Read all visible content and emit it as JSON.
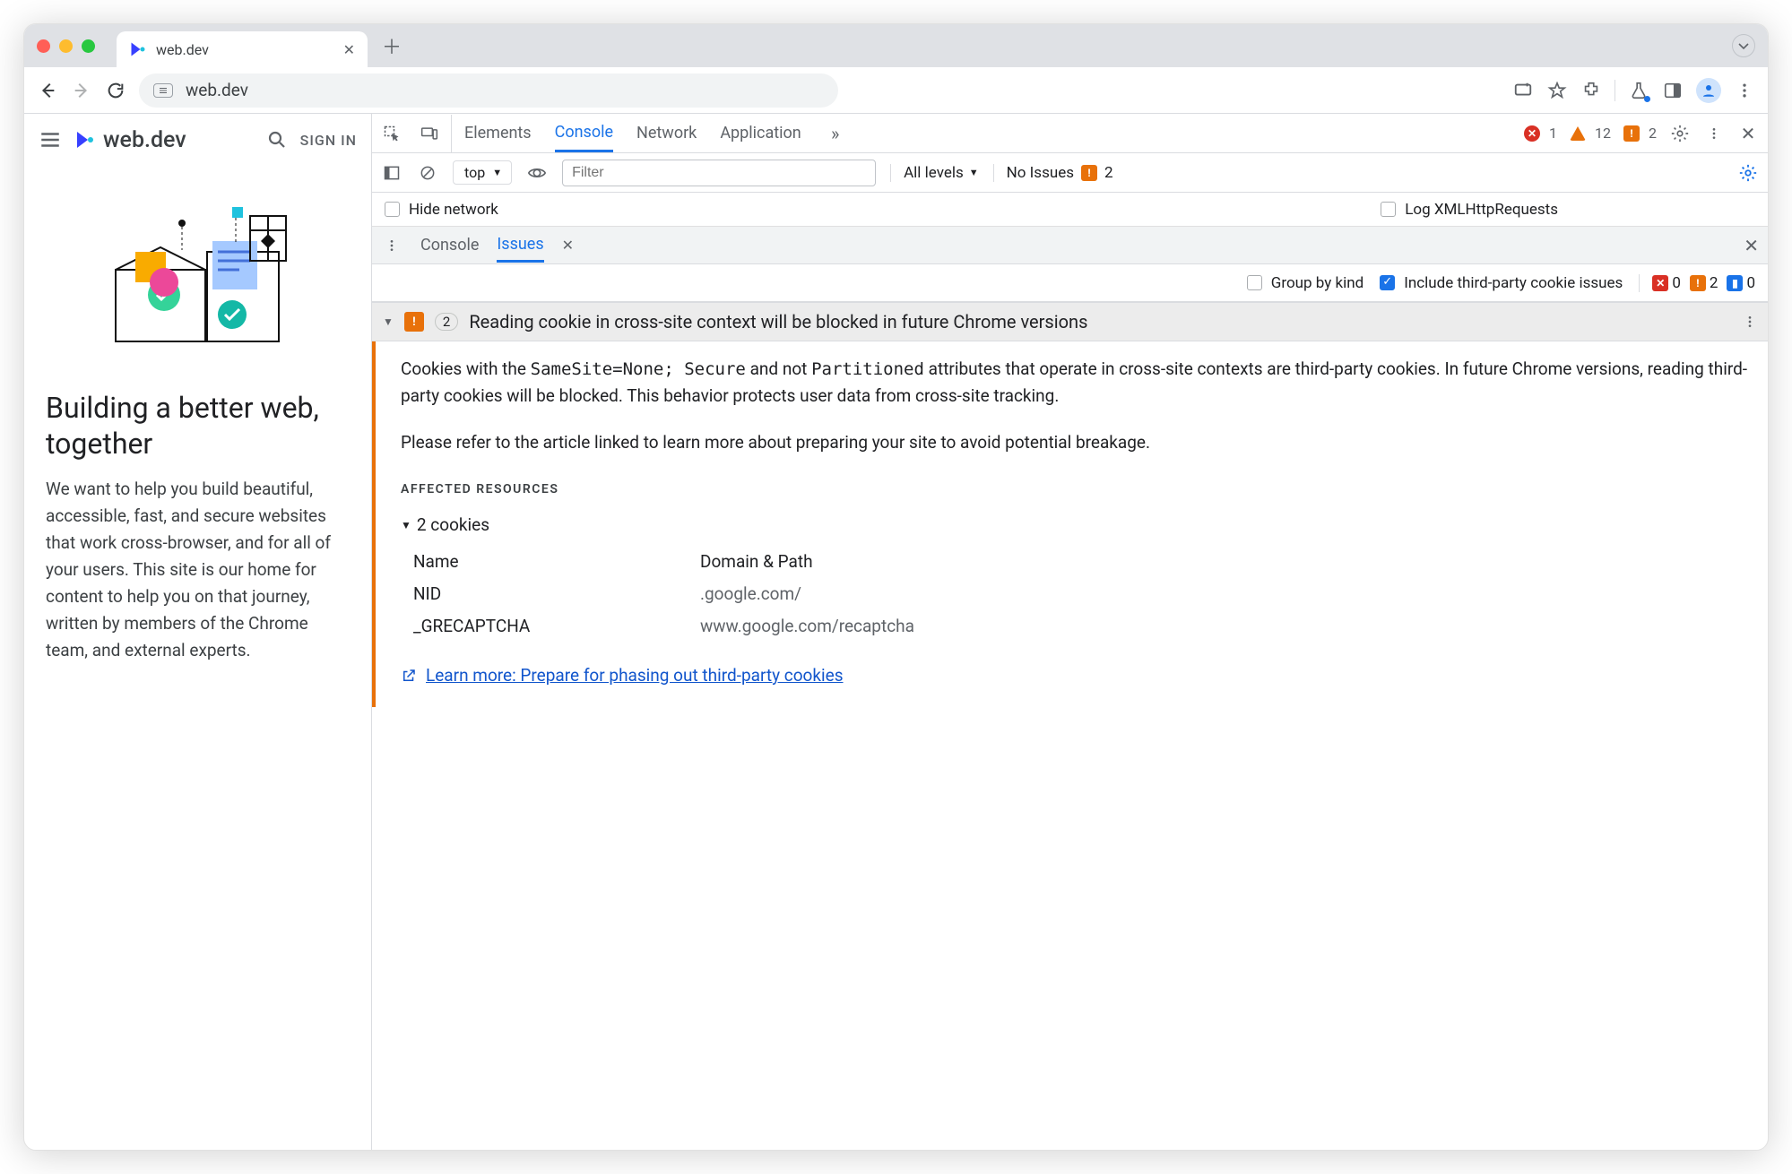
{
  "browser": {
    "tab_title": "web.dev",
    "url": "web.dev"
  },
  "page": {
    "brand": "web.dev",
    "signin": "SIGN IN",
    "headline": "Building a better web, together",
    "description": "We want to help you build beautiful, accessible, fast, and secure websites that work cross-browser, and for all of your users. This site is our home for content to help you on that journey, written by members of the Chrome team, and external experts."
  },
  "devtools": {
    "tabs": [
      "Elements",
      "Console",
      "Network",
      "Application"
    ],
    "active_tab": "Console",
    "status": {
      "errors": 1,
      "warnings": 12,
      "flags": 2
    },
    "filter": {
      "context": "top",
      "placeholder": "Filter",
      "levels": "All levels",
      "no_issues_label": "No Issues",
      "no_issues_count": 2
    },
    "console_settings": {
      "hide_network": "Hide network",
      "log_xhr": "Log XMLHttpRequests"
    },
    "drawer": {
      "tabs": [
        "Console",
        "Issues"
      ],
      "active": "Issues"
    },
    "issues_opts": {
      "group_by_kind": "Group by kind",
      "include_third_party": "Include third-party cookie issues",
      "counts": {
        "red": 0,
        "orange": 2,
        "blue": 0
      }
    },
    "issue": {
      "count": 2,
      "title": "Reading cookie in cross-site context will be blocked in future Chrome versions",
      "para1_pre": "Cookies with the ",
      "code1": "SameSite=None; Secure",
      "para1_mid": " and not ",
      "code2": "Partitioned",
      "para1_post": " attributes that operate in cross-site contexts are third-party cookies. In future Chrome versions, reading third-party cookies will be blocked. This behavior protects user data from cross-site tracking.",
      "para2": "Please refer to the article linked to learn more about preparing your site to avoid potential breakage.",
      "affected_label": "AFFECTED RESOURCES",
      "cookies_heading": "2 cookies",
      "table_headers": [
        "Name",
        "Domain & Path"
      ],
      "cookies": [
        {
          "name": "NID",
          "domain": ".google.com/"
        },
        {
          "name": "_GRECAPTCHA",
          "domain": "www.google.com/recaptcha"
        }
      ],
      "learn_more": "Learn more: Prepare for phasing out third-party cookies"
    }
  }
}
